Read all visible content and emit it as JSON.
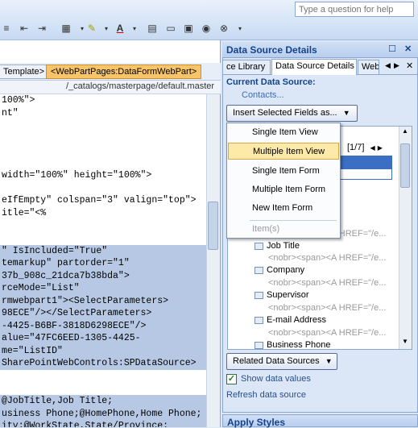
{
  "help": {
    "placeholder": "Type a question for help"
  },
  "tagbar": {
    "tag1": "Template>",
    "tag2": "<WebPartPages:DataFormWebPart>"
  },
  "pathbar": "/_catalogs/masterpage/default.master",
  "code": [
    {
      "text": "100%\">",
      "sel": false
    },
    {
      "text": "nt\"",
      "sel": false
    },
    {
      "text": "",
      "sel": false
    },
    {
      "text": "",
      "sel": false
    },
    {
      "text": "",
      "sel": false
    },
    {
      "text": "",
      "sel": false
    },
    {
      "text": "width=\"100%\" height=\"100%\">",
      "sel": false
    },
    {
      "text": "",
      "sel": false
    },
    {
      "text": "eIfEmpty\" colspan=\"3\" valign=\"top\">",
      "sel": false
    },
    {
      "text": "itle=\"<%",
      "sel": false
    },
    {
      "text": "",
      "sel": false
    },
    {
      "text": "",
      "sel": false
    },
    {
      "text": "\" IsIncluded=\"True\"",
      "sel": true
    },
    {
      "text": "temarkup\" partorder=\"1\"",
      "sel": true
    },
    {
      "text": "37b_908c_21dca7b38bda\">",
      "sel": true
    },
    {
      "text": "rceMode=\"List\"",
      "sel": true
    },
    {
      "text": "rmwebpart1\"><SelectParameters>",
      "sel": true
    },
    {
      "text": "98ECE\"/></SelectParameters>",
      "sel": true
    },
    {
      "text": "-4425-B6BF-3818D6298ECE\"/>",
      "sel": true
    },
    {
      "text": "alue=\"47FC6EED-1305-4425-",
      "sel": true
    },
    {
      "text": "me=\"ListID\"",
      "sel": true
    },
    {
      "text": "SharePointWebControls:SPDataSource>",
      "sel": true
    },
    {
      "text": "",
      "sel": false
    },
    {
      "text": "",
      "sel": false
    },
    {
      "text": "@JobTitle,Job Title;",
      "sel": true
    },
    {
      "text": "usiness Phone;@HomePhone,Home Phone;",
      "sel": true
    },
    {
      "text": "ity;@WorkState,State/Province;",
      "sel": true
    }
  ],
  "panel": {
    "title": "Data Source Details",
    "tabs": [
      "ce Library",
      "Data Source Details",
      "Web"
    ],
    "current_label": "Current Data Source:",
    "current_value": "Contacts...",
    "insert_button": "Insert Selected Fields as...",
    "pager": "[1/7]",
    "menu": [
      {
        "label": "Single Item View",
        "state": "normal"
      },
      {
        "label": "Multiple Item View",
        "state": "highlighted"
      },
      {
        "label": "Single Item Form",
        "state": "normal"
      },
      {
        "label": "Multiple Item Form",
        "state": "normal"
      },
      {
        "label": "New Item Form",
        "state": "normal"
      },
      {
        "label": "Item(s)",
        "state": "disabled"
      }
    ],
    "fields": [
      {
        "name": "Job Title",
        "value": "<nobr><span><A HREF=\"/e..."
      },
      {
        "name": "Company",
        "value": "<nobr><span><A HREF=\"/e..."
      },
      {
        "name": "Supervisor",
        "value": "<nobr><span><A HREF=\"/e..."
      },
      {
        "name": "E-mail Address",
        "value": "<nobr><span><A HREF=\"/e..."
      },
      {
        "name": "Business Phone",
        "value": "<nobr><span><A HREF=\"/e..."
      }
    ],
    "related_button": "Related Data Sources",
    "show_values_label": "Show data values",
    "show_values_checked": true,
    "refresh_label": "Refresh data source",
    "apply_styles": "Apply Styles"
  },
  "colors": {
    "accent": "#15428b",
    "highlight": "#fde9a8",
    "selection": "#b6c8e4"
  }
}
